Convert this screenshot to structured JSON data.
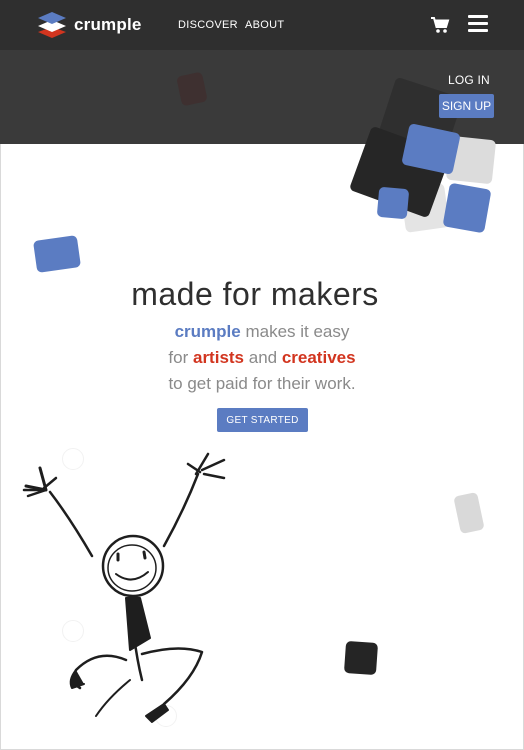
{
  "brand": {
    "name": "crumple"
  },
  "nav": {
    "links": [
      "DISCOVER",
      "ABOUT"
    ]
  },
  "auth": {
    "login": "LOG IN",
    "signup": "SIGN UP"
  },
  "hero": {
    "headline": "made for makers",
    "line1_brand": "crumple",
    "line1_rest": " makes it easy",
    "line2_for": "for ",
    "line2_artists": "artists",
    "line2_and": " and ",
    "line2_creatives": "creatives",
    "line3": "to get paid for their work.",
    "cta": "GET STARTED"
  },
  "colors": {
    "accent": "#5b7cc2",
    "highlight": "#d2351f",
    "nav_bg": "#2f2f2f",
    "band_bg": "#3a3a3a"
  },
  "icons": [
    "logo-stack-icon",
    "cart-icon",
    "hamburger-menu-icon"
  ]
}
